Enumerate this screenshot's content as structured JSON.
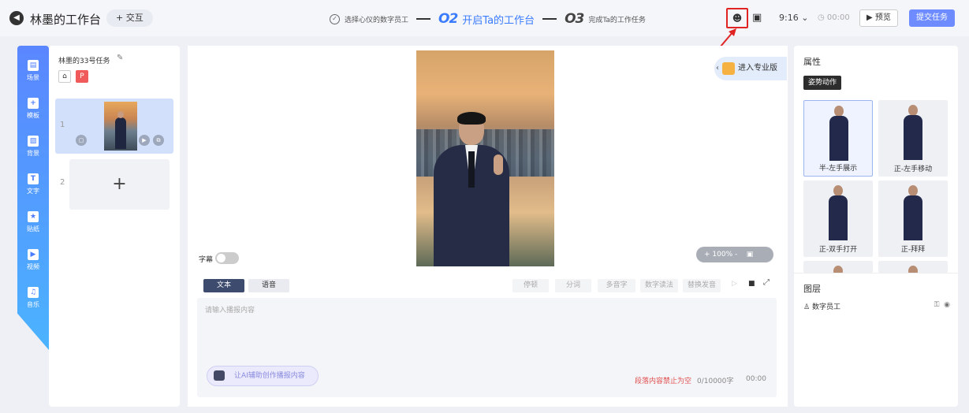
{
  "header": {
    "back_icon": "back-arrow-icon",
    "title": "林墨的工作台",
    "interact_label": "+ 交互",
    "step1_label": "选择心仪的数字员工",
    "step2_num": "O2",
    "step2_label": "开启Ta的工作台",
    "step3_num": "O3",
    "step3_label": "完成Ta的工作任务",
    "time_value": "9:16",
    "timer_value": "00:00",
    "preview_label": "预览",
    "submit_label": "提交任务"
  },
  "nav": {
    "items": [
      {
        "label": "场景",
        "icon": "scene-icon"
      },
      {
        "label": "模板",
        "icon": "template-icon"
      },
      {
        "label": "背景",
        "icon": "background-icon"
      },
      {
        "label": "文字",
        "icon": "text-icon"
      },
      {
        "label": "贴纸",
        "icon": "sticker-icon"
      },
      {
        "label": "视频",
        "icon": "video-icon"
      },
      {
        "label": "音乐",
        "icon": "music-icon"
      }
    ]
  },
  "scenes": {
    "task_title": "林墨的33号任务",
    "items": [
      {
        "index": "1"
      },
      {
        "index": "2"
      }
    ],
    "add_label": "+"
  },
  "canvas": {
    "pro_label": "进入专业版",
    "subtitle_label": "字幕",
    "zoom_text": "+ 100% -"
  },
  "editor": {
    "tab_text": "文本",
    "tab_audio": "语音",
    "tools": [
      "停顿",
      "分词",
      "多音字",
      "数字读法",
      "替换发音"
    ],
    "placeholder": "请输入播报内容",
    "ai_label": "让AI辅助创作播报内容",
    "warning": "段落内容禁止为空",
    "count": "0/10000字",
    "duration": "00:00"
  },
  "props": {
    "title": "属性",
    "pose_tag": "姿势动作",
    "poses": [
      "半-左手展示",
      "正-左手移动",
      "正-双手打开",
      "正-拜拜"
    ],
    "layers_title": "图层",
    "layer_name": "数字员工"
  }
}
